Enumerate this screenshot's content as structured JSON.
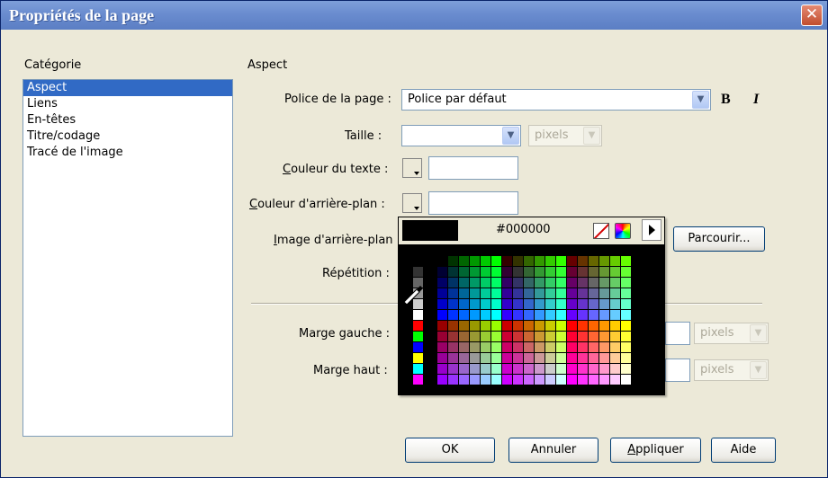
{
  "window": {
    "title": "Propriétés de la page"
  },
  "category": {
    "header": "Catégorie",
    "items": [
      "Aspect",
      "Liens",
      "En-têtes",
      "Titre/codage",
      "Tracé de l'image"
    ]
  },
  "section": {
    "title": "Aspect"
  },
  "form": {
    "font_label": "Police de la page :",
    "font_value": "Police par défaut",
    "bold": "B",
    "italic": "I",
    "size_label": "Taille :",
    "size_value": "",
    "size_unit": "pixels",
    "text_color_label": "Couleur du texte :",
    "text_color_value": "",
    "bg_color_label": "Couleur d'arrière-plan :",
    "bg_color_value": "",
    "bg_image_label": "Image d'arrière-plan :",
    "browse_button": "Parcourir...",
    "repeat_label": "Répétition :",
    "left_margin_label": "Marge gauche :",
    "left_margin_unit": "pixels",
    "top_margin_label": "Marge haut :",
    "top_margin_unit": "pixels"
  },
  "picker": {
    "hex": "#000000"
  },
  "buttons": {
    "ok": "OK",
    "cancel": "Annuler",
    "apply": "Appliquer",
    "help": "Aide"
  },
  "colors": {
    "titlebar": "#6a8ccf",
    "selection": "#316ac5",
    "dialog": "#ece9d8"
  }
}
